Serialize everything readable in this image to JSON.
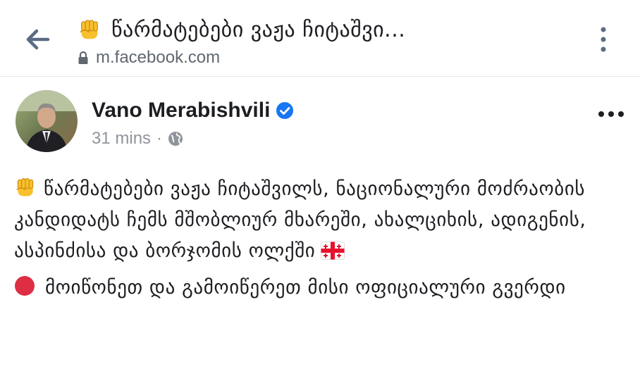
{
  "browser": {
    "page_title": "წარმატებები ვაჟა ჩიტაშვი...",
    "title_icon": "raised-fist-emoji",
    "url": "m.facebook.com",
    "back_icon": "back-arrow-icon",
    "menu_icon": "vertical-ellipsis-icon"
  },
  "post": {
    "author": "Vano Merabishvili",
    "verified": true,
    "time": "31 mins",
    "separator": "·",
    "audience_icon": "globe-icon",
    "menu_icon": "horizontal-ellipsis-icon",
    "paragraph_1": "წარმატებები ვაჟა ჩიტაშვილს, ნაციონალური მოძრაობის კანდიდატს ჩემს მშობლიურ მხარეში, ახალციხის, ადიგენის, ასპინძისა და ბორჯომის ოლქში",
    "paragraph_1_lead_icon": "raised-fist-emoji",
    "paragraph_1_trail_icon": "georgia-flag-emoji",
    "paragraph_2": "მოიწონეთ და გამოიწერეთ მისი ოფიციალური გვერდი",
    "paragraph_2_lead_icon": "red-circle-emoji"
  },
  "colors": {
    "text": "#1c1e21",
    "muted": "#90949c",
    "url": "#606770",
    "verified": "#1877f2",
    "back_arrow": "#5b6b85",
    "red_circle": "#dd2e44",
    "fist": "#f8c02c"
  }
}
